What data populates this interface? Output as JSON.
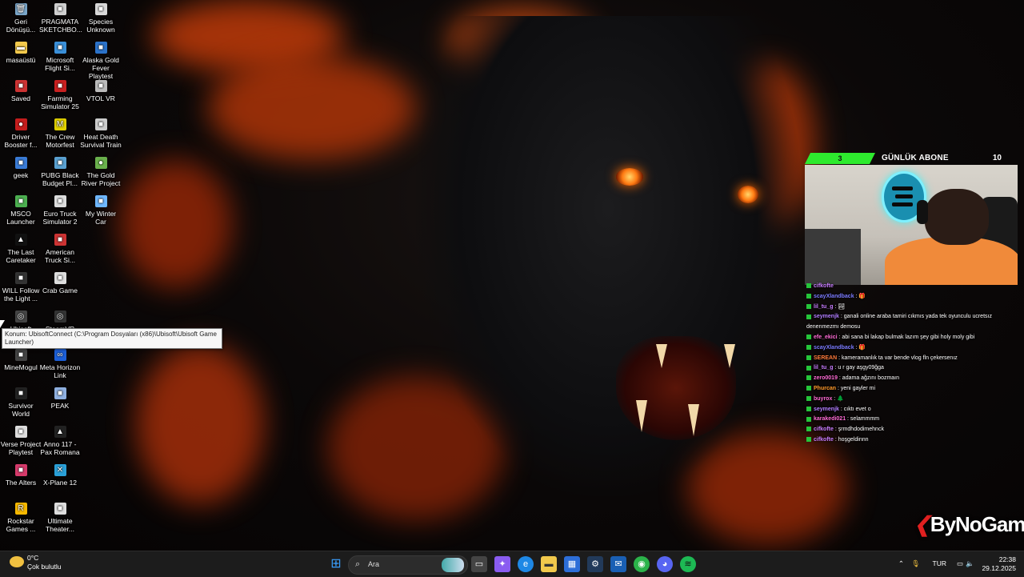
{
  "desktop": {
    "icons": [
      {
        "label": "Geri Dönüşü...",
        "icon": "recycle-bin-icon",
        "color": "#7aa6c9",
        "glyph": "🗑"
      },
      {
        "label": "PRAGMATA SKETCHBO...",
        "icon": "game-icon",
        "color": "#cfcfcf",
        "glyph": "■"
      },
      {
        "label": "Species Unknown",
        "icon": "game-icon",
        "color": "#d8d8d8",
        "glyph": "■"
      },
      {
        "label": "masaüstü",
        "icon": "folder-icon",
        "color": "#f2c94c",
        "glyph": "▬"
      },
      {
        "label": "Microsoft Flight Si...",
        "icon": "game-icon",
        "color": "#3a8fd8",
        "glyph": "■"
      },
      {
        "label": "Alaska Gold Fever Playtest",
        "icon": "game-icon",
        "color": "#2b72c9",
        "glyph": "■"
      },
      {
        "label": "Saved",
        "icon": "game-icon",
        "color": "#c33",
        "glyph": "■"
      },
      {
        "label": "Farming Simulator 25",
        "icon": "game-icon",
        "color": "#c82020",
        "glyph": "■"
      },
      {
        "label": "VTOL VR",
        "icon": "game-icon",
        "color": "#bbb",
        "glyph": "■"
      },
      {
        "label": "Driver Booster f...",
        "icon": "driver-booster-icon",
        "color": "#c41d1d",
        "glyph": "●"
      },
      {
        "label": "The Crew Motorfest",
        "icon": "game-icon",
        "color": "#e0d000",
        "glyph": "M"
      },
      {
        "label": "Heat Death Survival Train",
        "icon": "game-icon",
        "color": "#ccc",
        "glyph": "■"
      },
      {
        "label": "geek",
        "icon": "geek-uninstaller-icon",
        "color": "#3a7bd5",
        "glyph": "■"
      },
      {
        "label": "PUBG Black Budget Pl...",
        "icon": "game-icon",
        "color": "#5aa0d0",
        "glyph": "■"
      },
      {
        "label": "The Gold River Project",
        "icon": "game-icon",
        "color": "#6ab04c",
        "glyph": "●"
      },
      {
        "label": "MSCO Launcher",
        "icon": "game-icon",
        "color": "#4caf50",
        "glyph": "■"
      },
      {
        "label": "Euro Truck Simulator 2",
        "icon": "game-icon",
        "color": "#ddd",
        "glyph": "■"
      },
      {
        "label": "My Winter Car",
        "icon": "game-icon",
        "color": "#6fb7ff",
        "glyph": "■"
      },
      {
        "label": "The Last Caretaker",
        "icon": "game-icon",
        "color": "#111",
        "glyph": "▲"
      },
      {
        "label": "American Truck Si...",
        "icon": "game-icon",
        "color": "#c33",
        "glyph": "■"
      },
      {
        "label": "WILL Follow the Light ...",
        "icon": "game-icon",
        "color": "#333",
        "glyph": "■"
      },
      {
        "label": "Crab Game",
        "icon": "game-icon",
        "color": "#ddd",
        "glyph": "■"
      },
      {
        "label": "Ubisoft",
        "icon": "ubisoft-connect-icon",
        "color": "#444",
        "glyph": "◎"
      },
      {
        "label": "SteamVR",
        "icon": "steamvr-icon",
        "color": "#333",
        "glyph": "◎"
      },
      {
        "label": "MineMogul",
        "icon": "game-icon",
        "color": "#444",
        "glyph": "■"
      },
      {
        "label": "Meta Horizon Link",
        "icon": "meta-icon",
        "color": "#1c5fd8",
        "glyph": "∞"
      },
      {
        "label": "Survivor World",
        "icon": "game-icon",
        "color": "#222",
        "glyph": "■"
      },
      {
        "label": "PEAK",
        "icon": "game-icon",
        "color": "#8fb0e0",
        "glyph": "■"
      },
      {
        "label": "Verse Project Playtest",
        "icon": "game-icon",
        "color": "#ddd",
        "glyph": "■"
      },
      {
        "label": "Anno 117 - Pax Romana",
        "icon": "game-icon",
        "color": "#222",
        "glyph": "▲"
      },
      {
        "label": "The Alters",
        "icon": "game-icon",
        "color": "#d43a6a",
        "glyph": "■"
      },
      {
        "label": "X-Plane 12",
        "icon": "game-icon",
        "color": "#2aa0d8",
        "glyph": "✕"
      },
      {
        "label": "Rockstar Games ...",
        "icon": "rockstar-icon",
        "color": "#f5b800",
        "glyph": "R"
      },
      {
        "label": "Ultimate Theater...",
        "icon": "game-icon",
        "color": "#ddd",
        "glyph": "■"
      }
    ],
    "tooltip": "Konum: UbisoftConnect (C:\\Program Dosyaları (x86)\\Ubisoft\\Ubisoft Game Launcher)"
  },
  "overlay": {
    "abone_current": "3",
    "abone_title": "GÜNLÜK ABONE",
    "abone_target": "10",
    "watermark": "ByNoGame"
  },
  "chat": [
    {
      "user": "cifkofte",
      "text": "",
      "color": "#c77dff"
    },
    {
      "user": "scayXlandback",
      "text": ": 🎁",
      "color": "#7b7bff"
    },
    {
      "user": "lil_tu_g",
      "text": ": 🏞",
      "color": "#c77dff"
    },
    {
      "user": "seymenjk",
      "text": ": ganali online araba tamiri cıkmıs yada tek oyunculu ucretsız denenmezmı demosu",
      "color": "#b07dff"
    },
    {
      "user": "efe_ekici",
      "text": ": abi sana bi lakap bulmak lazım şey gibi holy moly gibi",
      "color": "#ff6bd5"
    },
    {
      "user": "scayXlandback",
      "text": ": 🎁",
      "color": "#7b7bff"
    },
    {
      "user": "SEREAN",
      "text": ": kameramanlık ta var bende vlog fln çekersenız",
      "color": "#ff7a3a"
    },
    {
      "user": "lil_tu_g",
      "text": ": u r gay aşgy09ğga",
      "color": "#c77dff"
    },
    {
      "user": "zero0019",
      "text": ": adama ağzını bozmaın",
      "color": "#ff6bd5"
    },
    {
      "user": "Phurcan",
      "text": ": yeni gayler mi",
      "color": "#ff9a2a"
    },
    {
      "user": "buyrox",
      "text": ": 🌲",
      "color": "#ff6bd5"
    },
    {
      "user": "seymenjk",
      "text": ": cıktı evet o",
      "color": "#b07dff"
    },
    {
      "user": "karakedi021",
      "text": ": selammmm",
      "color": "#ff6bd5"
    },
    {
      "user": "cifkofte",
      "text": ": şrmdhdodimehnck",
      "color": "#c77dff"
    },
    {
      "user": "cifkofte",
      "text": ": hoşgeldinnn",
      "color": "#c77dff"
    }
  ],
  "taskbar": {
    "weather_temp": "0°C",
    "weather_desc": "Çok bulutlu",
    "search_placeholder": "Ara",
    "language": "TUR",
    "time": "22:38",
    "date": "29.12.2025"
  }
}
